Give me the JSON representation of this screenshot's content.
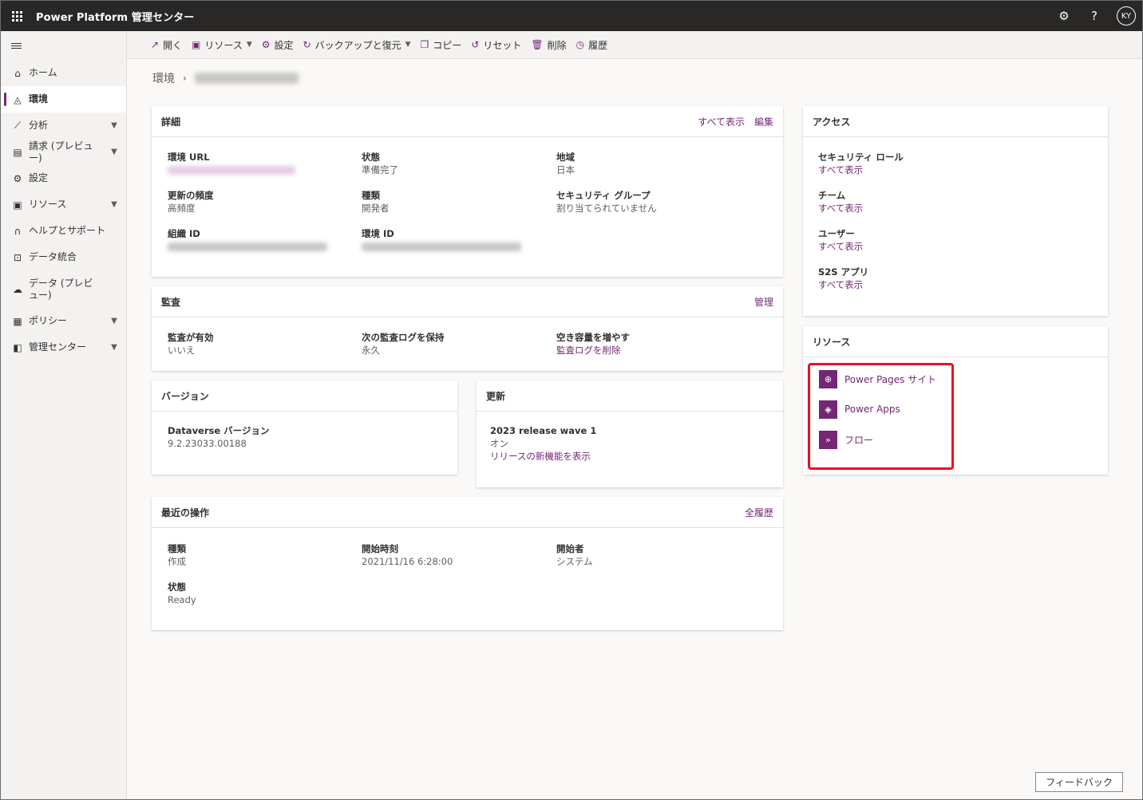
{
  "app": {
    "title": "Power Platform 管理センター",
    "avatar_initials": "KY"
  },
  "sidebar": {
    "items": [
      {
        "label": "ホーム",
        "icon": "home-icon",
        "chevron": false,
        "active": false
      },
      {
        "label": "環境",
        "icon": "environment-icon",
        "chevron": false,
        "active": true
      },
      {
        "label": "分析",
        "icon": "chart-icon",
        "chevron": true,
        "active": false
      },
      {
        "label": "請求 (プレビュー)",
        "icon": "billing-icon",
        "chevron": true,
        "active": false
      },
      {
        "label": "設定",
        "icon": "gear-icon",
        "chevron": false,
        "active": false
      },
      {
        "label": "リソース",
        "icon": "resources-icon",
        "chevron": true,
        "active": false
      },
      {
        "label": "ヘルプとサポート",
        "icon": "headset-icon",
        "chevron": false,
        "active": false
      },
      {
        "label": "データ統合",
        "icon": "data-integration-icon",
        "chevron": false,
        "active": false
      },
      {
        "label": "データ (プレビュー)",
        "icon": "cloud-data-icon",
        "chevron": false,
        "active": false
      },
      {
        "label": "ポリシー",
        "icon": "policy-icon",
        "chevron": true,
        "active": false
      },
      {
        "label": "管理センター",
        "icon": "admin-center-icon",
        "chevron": true,
        "active": false
      }
    ]
  },
  "commands": [
    {
      "label": "開く",
      "icon": "open-icon",
      "dropdown": false
    },
    {
      "label": "リソース",
      "icon": "resources-icon",
      "dropdown": true
    },
    {
      "label": "設定",
      "icon": "gear-icon",
      "dropdown": false
    },
    {
      "label": "バックアップと復元",
      "icon": "backup-icon",
      "dropdown": true
    },
    {
      "label": "コピー",
      "icon": "copy-icon",
      "dropdown": false
    },
    {
      "label": "リセット",
      "icon": "reset-icon",
      "dropdown": false
    },
    {
      "label": "削除",
      "icon": "delete-icon",
      "dropdown": false
    },
    {
      "label": "履歴",
      "icon": "history-icon",
      "dropdown": false
    }
  ],
  "breadcrumb": {
    "root": "環境",
    "current": ""
  },
  "details": {
    "title": "詳細",
    "link_all": "すべて表示",
    "link_edit": "編集",
    "env_url_label": "環境 URL",
    "state_label": "状態",
    "state_value": "準備完了",
    "region_label": "地域",
    "region_value": "日本",
    "freq_label": "更新の頻度",
    "freq_value": "高頻度",
    "type_label": "種類",
    "type_value": "開発者",
    "secgroup_label": "セキュリティ グループ",
    "secgroup_value": "割り当てられていません",
    "org_id_label": "組織 ID",
    "env_id_label": "環境 ID"
  },
  "audit": {
    "title": "監査",
    "link_manage": "管理",
    "enabled_label": "監査が有効",
    "enabled_value": "いいえ",
    "retain_label": "次の監査ログを保持",
    "retain_value": "永久",
    "free_label": "空き容量を増やす",
    "free_link": "監査ログを削除"
  },
  "version": {
    "title": "バージョン",
    "dv_label": "Dataverse バージョン",
    "dv_value": "9.2.23033.00188"
  },
  "update": {
    "title": "更新",
    "wave_label": "2023 release wave 1",
    "wave_value": "オン",
    "link": "リリースの新機能を表示"
  },
  "recent": {
    "title": "最近の操作",
    "link_all": "全履歴",
    "type_label": "種類",
    "type_value": "作成",
    "start_label": "開始時刻",
    "start_value": "2021/11/16 6:28:00",
    "by_label": "開始者",
    "by_value": "システム",
    "state_label": "状態",
    "state_value": "Ready"
  },
  "access": {
    "title": "アクセス",
    "items": [
      {
        "label": "セキュリティ ロール",
        "link": "すべて表示"
      },
      {
        "label": "チーム",
        "link": "すべて表示"
      },
      {
        "label": "ユーザー",
        "link": "すべて表示"
      },
      {
        "label": "S2S アプリ",
        "link": "すべて表示"
      }
    ]
  },
  "resources": {
    "title": "リソース",
    "items": [
      {
        "label": "Power Pages サイト",
        "icon": "globe-icon"
      },
      {
        "label": "Power Apps",
        "icon": "power-apps-icon"
      },
      {
        "label": "フロー",
        "icon": "flow-icon"
      }
    ]
  },
  "feedback": {
    "label": "フィードバック"
  },
  "colors": {
    "accent": "#742774",
    "topbar": "#292827",
    "highlight": "#e81123"
  }
}
